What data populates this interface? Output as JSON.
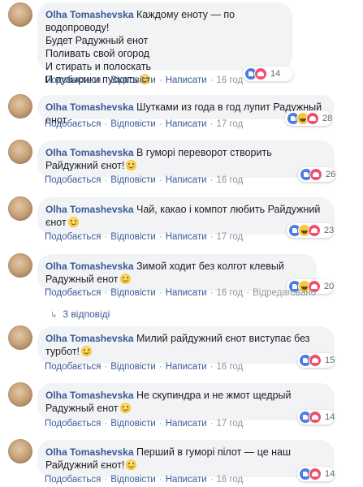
{
  "labels": {
    "like": "Подобається",
    "reply": "Відповісти",
    "message": "Написати"
  },
  "comments": [
    {
      "author": "Olha Tomashevska",
      "text": "Каждому еноту — по водопроводу!\nБудет Радужный енот\nПоливать свой огород\nИ стирать и полоскать\nИ пузырики пускать",
      "has_emoji": true,
      "time": "16 год",
      "edited": "",
      "reactions": [
        "like-icon",
        "love-icon"
      ],
      "count": "14"
    },
    {
      "author": "Olha Tomashevska",
      "text": "Шутками из года в год лупит Радужный енот",
      "has_emoji": false,
      "time": "17 год",
      "edited": "",
      "reactions": [
        "like-icon",
        "haha-icon",
        "love-icon"
      ],
      "count": "28"
    },
    {
      "author": "Olha Tomashevska",
      "text": "В гуморі переворот створить Райдужний єнот!",
      "has_emoji": true,
      "time": "16 год",
      "edited": "",
      "reactions": [
        "like-icon",
        "love-icon"
      ],
      "count": "26"
    },
    {
      "author": "Olha Tomashevska",
      "text": "Чай, какао і компот любить Райдужний єнот",
      "has_emoji": true,
      "time": "17 год",
      "edited": "",
      "reactions": [
        "like-icon",
        "haha-icon",
        "love-icon"
      ],
      "count": "23"
    },
    {
      "author": "Olha Tomashevska",
      "text": "Зимой ходит без колгот клевый Радужный енот",
      "has_emoji": true,
      "time": "16 год",
      "edited": "Відредаговано",
      "reactions": [
        "like-icon",
        "haha-icon",
        "love-icon"
      ],
      "count": "20"
    },
    {
      "author": "Olha Tomashevska",
      "text": "Милий райдужний єнот виступає без турбот!",
      "has_emoji": true,
      "time": "16 год",
      "edited": "",
      "reactions": [
        "like-icon",
        "love-icon"
      ],
      "count": "15"
    },
    {
      "author": "Olha Tomashevska",
      "text": "Не скупиндра и не жмот щедрый Радужный енот",
      "has_emoji": true,
      "time": "17 год",
      "edited": "",
      "reactions": [
        "like-icon",
        "love-icon"
      ],
      "count": "14"
    },
    {
      "author": "Olha Tomashevska",
      "text": "Перший в гуморі пілот — це наш Райдужний єнот!",
      "has_emoji": true,
      "time": "16 год",
      "edited": "",
      "reactions": [
        "like-icon",
        "love-icon"
      ],
      "count": "14"
    }
  ],
  "replies_link": "3 відповіді",
  "colors": {
    "link": "#385898",
    "bubble": "#f2f3f5",
    "like": "#4d7de0",
    "love": "#f0506e",
    "haha": "#f7c737"
  }
}
